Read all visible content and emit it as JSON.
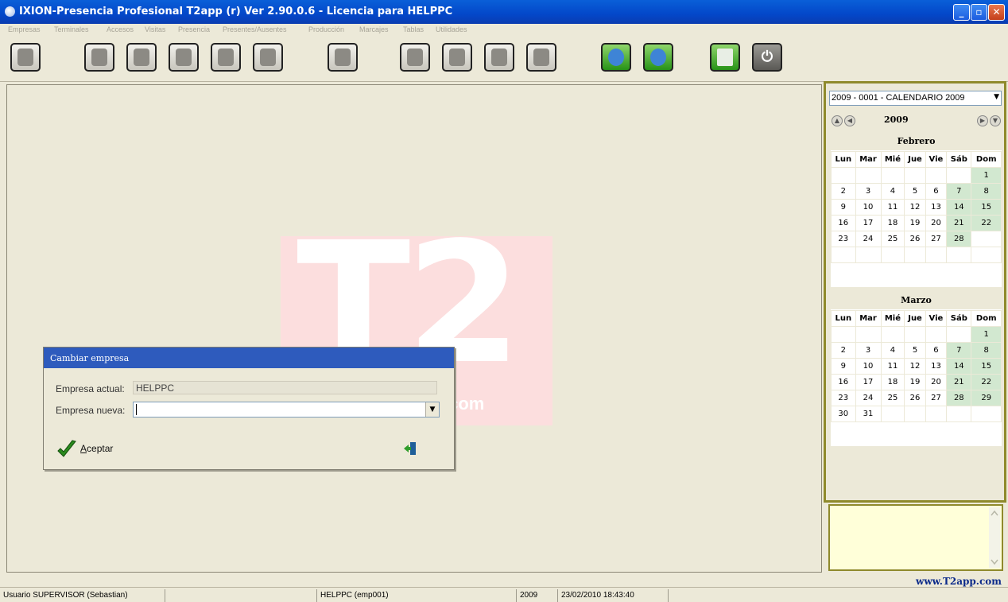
{
  "window": {
    "title": "IXION-Presencia Profesional T2app (r) Ver 2.90.0.6  -  Licencia para HELPPC"
  },
  "menu": [
    "Empresas",
    "Terminales",
    "Accesos",
    "Visitas",
    "Presencia",
    "Presentes/Ausentes",
    "Producción",
    "Marcajes",
    "Tablas",
    "Utilidades"
  ],
  "toolbar": {
    "icons": [
      "users-icon",
      "clock-icon",
      "tools-icon",
      "gear-icon",
      "terminal-icon",
      "printer-icon",
      "help-icon",
      "card-icon",
      "person-icon",
      "calendar-icon",
      "check-icon",
      "sync-icon",
      "info-icon",
      "calculator-icon",
      "power-icon"
    ]
  },
  "logo": {
    "big": "T2",
    "com": ".com"
  },
  "dialog": {
    "title": "Cambiar empresa",
    "current_label": "Empresa actual:",
    "current_value": "HELPPC",
    "new_label": "Empresa nueva:",
    "new_value": "",
    "accept_prefix": "A",
    "accept_rest": "ceptar"
  },
  "calendar": {
    "selector": "2009 - 0001 - CALENDARIO 2009",
    "year": "2009",
    "weekdays": [
      "Lun",
      "Mar",
      "Mié",
      "Jue",
      "Vie",
      "Sáb",
      "Dom"
    ],
    "months": [
      {
        "name": "Febrero",
        "rows": [
          [
            "",
            "",
            "",
            "",
            "",
            "",
            "1"
          ],
          [
            "2",
            "3",
            "4",
            "5",
            "6",
            "7",
            "8"
          ],
          [
            "9",
            "10",
            "11",
            "12",
            "13",
            "14",
            "15"
          ],
          [
            "16",
            "17",
            "18",
            "19",
            "20",
            "21",
            "22"
          ],
          [
            "23",
            "24",
            "25",
            "26",
            "27",
            "28",
            ""
          ],
          [
            "",
            "",
            "",
            "",
            "",
            "",
            ""
          ]
        ]
      },
      {
        "name": "Marzo",
        "rows": [
          [
            "",
            "",
            "",
            "",
            "",
            "",
            "1"
          ],
          [
            "2",
            "3",
            "4",
            "5",
            "6",
            "7",
            "8"
          ],
          [
            "9",
            "10",
            "11",
            "12",
            "13",
            "14",
            "15"
          ],
          [
            "16",
            "17",
            "18",
            "19",
            "20",
            "21",
            "22"
          ],
          [
            "23",
            "24",
            "25",
            "26",
            "27",
            "28",
            "29"
          ],
          [
            "30",
            "31",
            "",
            "",
            "",
            "",
            ""
          ]
        ]
      }
    ],
    "weekend_color": "#d2e8d0"
  },
  "url": "www.T2app.com",
  "status": {
    "user": "Usuario SUPERVISOR (Sebastian)",
    "company": "HELPPC  (emp001)",
    "year": "2009",
    "datetime": "23/02/2010  18:43:40"
  }
}
